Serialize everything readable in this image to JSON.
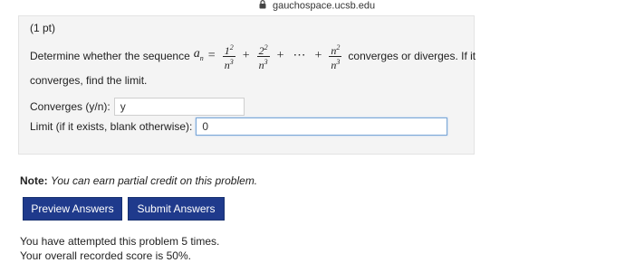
{
  "browser": {
    "url": "gauchospace.ucsb.edu",
    "lock_icon": "lock-icon"
  },
  "problem": {
    "points": "(1 pt)",
    "text_before": "Determine whether the sequence",
    "sequence_var": "a",
    "sequence_sub": "n",
    "equals": "=",
    "term1_num": "1",
    "term1_num_exp": "2",
    "term2_num": "2",
    "term2_num_exp": "2",
    "term3_num": "n",
    "term3_num_exp": "2",
    "den": "n",
    "den_exp": "3",
    "plus": "+",
    "ellipsis": "⋯",
    "text_after": "converges or diverges. If it",
    "text_line2": "converges, find the limit."
  },
  "answers": {
    "converges_label": "Converges (y/n):",
    "converges_value": "y",
    "limit_label": "Limit (if it exists, blank otherwise):",
    "limit_value": "0"
  },
  "note": {
    "label": "Note:",
    "text": "You can earn partial credit on this problem."
  },
  "buttons": {
    "preview": "Preview Answers",
    "submit": "Submit Answers"
  },
  "status": {
    "attempts": "You have attempted this problem 5 times.",
    "score": "Your overall recorded score is 50%."
  }
}
